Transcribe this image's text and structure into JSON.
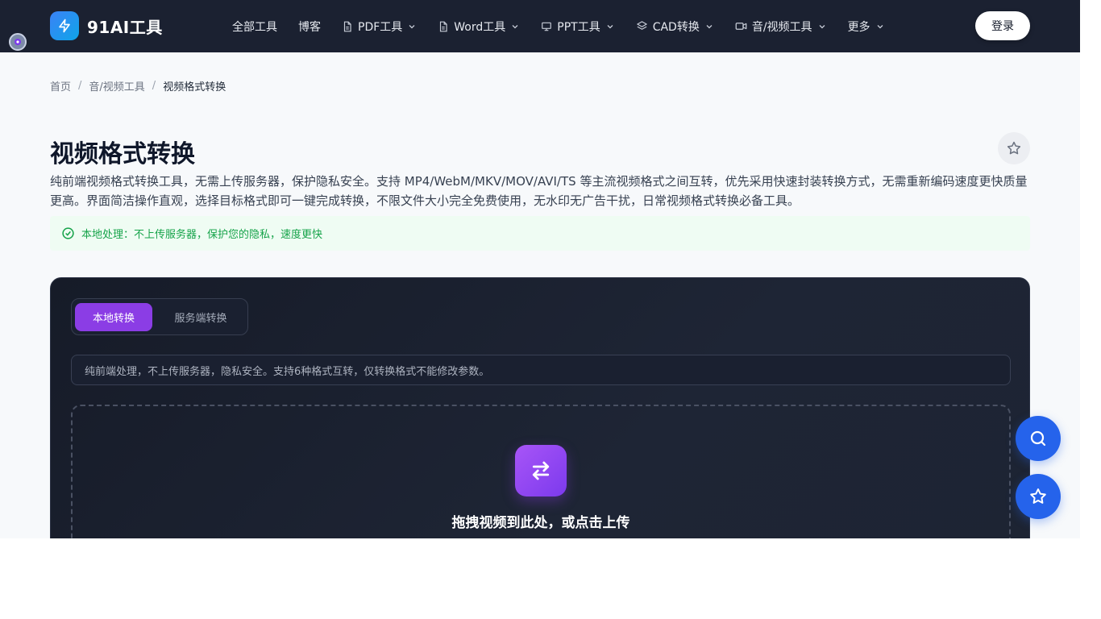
{
  "header": {
    "brand": "91AI工具",
    "nav": [
      {
        "label": "全部工具",
        "icon": "",
        "dropdown": false
      },
      {
        "label": "博客",
        "icon": "",
        "dropdown": false
      },
      {
        "label": "PDF工具",
        "icon": "document-icon",
        "dropdown": true
      },
      {
        "label": "Word工具",
        "icon": "document-icon",
        "dropdown": true
      },
      {
        "label": "PPT工具",
        "icon": "presentation-icon",
        "dropdown": true
      },
      {
        "label": "CAD转换",
        "icon": "layers-icon",
        "dropdown": true
      },
      {
        "label": "音/视频工具",
        "icon": "video-icon",
        "dropdown": true
      },
      {
        "label": "更多",
        "icon": "",
        "dropdown": true
      }
    ],
    "login_label": "登录"
  },
  "breadcrumb": {
    "home": "首页",
    "parent": "音/视频工具",
    "current": "视频格式转换"
  },
  "page": {
    "title": "视频格式转换",
    "description": "纯前端视频格式转换工具，无需上传服务器，保护隐私安全。支持 MP4/WebM/MKV/MOV/AVI/TS 等主流视频格式之间互转，优先采用快速封装转换方式，无需重新编码速度更快质量更高。界面简洁操作直观，选择目标格式即可一键完成转换，不限文件大小完全免费使用，无水印无广告干扰，日常视频格式转换必备工具。",
    "notice": "本地处理：不上传服务器，保护您的隐私，速度更快"
  },
  "converter": {
    "tabs": [
      {
        "label": "本地转换",
        "active": true
      },
      {
        "label": "服务端转换",
        "active": false
      }
    ],
    "info": "纯前端处理，不上传服务器，隐私安全。支持6种格式互转，仅转换格式不能修改参数。",
    "drop_text": "拖拽视频到此处，或点击上传"
  },
  "colors": {
    "header_bg": "#1b2131",
    "accent_purple": "#8b3de5",
    "success_green": "#16a34a",
    "float_blue": "#2563eb"
  }
}
